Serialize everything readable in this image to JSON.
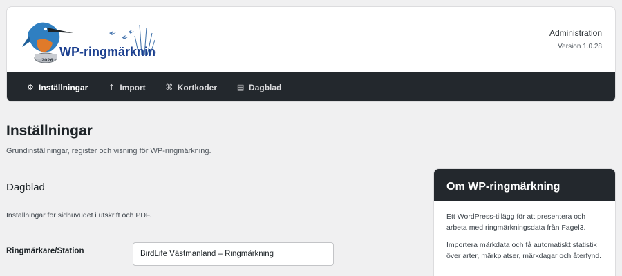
{
  "header": {
    "logo_text": "WP-ringmärkning",
    "logo_badge": "2026",
    "admin_title": "Administration",
    "version": "Version 1.0.28"
  },
  "nav": {
    "items": [
      {
        "label": "Inställningar",
        "icon": "gear-icon",
        "active": true
      },
      {
        "label": "Import",
        "icon": "upload-arrow-icon",
        "active": false
      },
      {
        "label": "Kortkoder",
        "icon": "command-icon",
        "active": false
      },
      {
        "label": "Dagblad",
        "icon": "list-icon",
        "active": false
      }
    ]
  },
  "page": {
    "title": "Inställningar",
    "description": "Grundinställningar, register och visning för WP-ringmärkning."
  },
  "section": {
    "title": "Dagblad",
    "description": "Inställningar för sidhuvudet i utskrift och PDF.",
    "field_label": "Ringmärkare/Station",
    "field_value": "BirdLife Västmanland – Ringmärkning"
  },
  "about": {
    "title": "Om WP-ringmärkning",
    "p1": "Ett WordPress-tillägg för att presentera och arbeta med ringmärkningsdata från Fagel3.",
    "p2": "Importera märkdata och få automatiskt statistik över arter, märkplatser, märkdagar och återfynd."
  },
  "colors": {
    "nav_bg": "#23282d",
    "accent": "#2271b1",
    "page_bg": "#f0f0f1"
  }
}
